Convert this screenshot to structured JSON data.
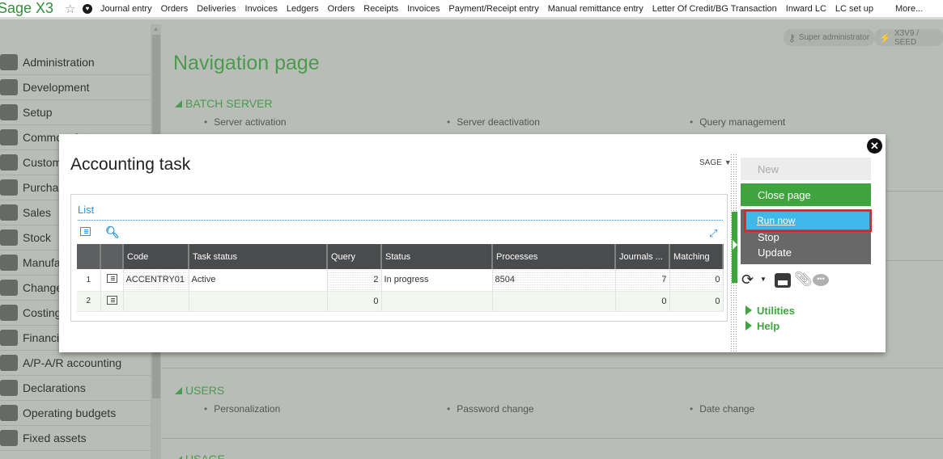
{
  "app": {
    "brand": "Sage X3",
    "favorites_icon": "star-icon",
    "shortcut_icon": "heart-icon"
  },
  "topnav": {
    "links": [
      "Journal entry",
      "Orders",
      "Deliveries",
      "Invoices",
      "Ledgers",
      "Orders",
      "Receipts",
      "Invoices",
      "Payment/Receipt entry",
      "Manual remittance entry",
      "Letter Of Credit/BG Transaction",
      "Inward LC",
      "LC set up"
    ],
    "more": "More..."
  },
  "user": {
    "role": "Super administrator",
    "role_icon": "key-icon",
    "endpoint": "X3V9 / SEED",
    "endpoint_icon": "plug-icon"
  },
  "sidebar": {
    "items": [
      {
        "label": "Administration",
        "icon": "id-badge-icon"
      },
      {
        "label": "Development",
        "icon": "hard-hat-icon"
      },
      {
        "label": "Setup",
        "icon": "gears-icon"
      },
      {
        "label": "Common data",
        "icon": "binders-icon"
      },
      {
        "label": "Customers",
        "icon": "handshake-icon"
      },
      {
        "label": "Purchasing",
        "icon": "purse-icon"
      },
      {
        "label": "Sales",
        "icon": "hand-coins-icon"
      },
      {
        "label": "Stock",
        "icon": "box-icon"
      },
      {
        "label": "Manufacturing",
        "icon": "factory-icon"
      },
      {
        "label": "Change",
        "icon": "gear-icon"
      },
      {
        "label": "Costing",
        "icon": "chart-board-icon"
      },
      {
        "label": "Financials",
        "icon": "calculator-icon"
      },
      {
        "label": "A/P-A/R accounting",
        "icon": "calendar-icon"
      },
      {
        "label": "Declarations",
        "icon": "bank-icon"
      },
      {
        "label": "Operating budgets",
        "icon": "wallet-icon"
      },
      {
        "label": "Fixed assets",
        "icon": "monitor-icon"
      }
    ]
  },
  "navigation": {
    "title": "Navigation page",
    "sections": [
      {
        "title": "BATCH SERVER",
        "links": [
          "Server activation",
          "Server deactivation",
          "Query management"
        ]
      },
      {
        "title": "USERS",
        "links": [
          "Personalization",
          "Password change",
          "Date change"
        ]
      },
      {
        "title": "USAGE",
        "links": []
      }
    ]
  },
  "modal": {
    "title": "Accounting task",
    "folder": "SAGE",
    "close_icon": "close-icon",
    "list": {
      "title": "List",
      "columns": [
        "Code",
        "Task status",
        "Query",
        "Status",
        "Processes",
        "Journals ...",
        "Matching"
      ],
      "rows": [
        {
          "num": "1",
          "code": "ACCENTRY01",
          "task_status": "Active",
          "query": "2",
          "status": "In progress",
          "processes": "8504",
          "journals": "7",
          "matching": "0"
        },
        {
          "num": "2",
          "code": "",
          "task_status": "",
          "query": "0",
          "status": "",
          "processes": "",
          "journals": "0",
          "matching": "0"
        }
      ]
    },
    "actions": {
      "new": "New",
      "close_page": "Close page",
      "run_now": "Run now",
      "stop": "Stop",
      "update": "Update"
    },
    "links": {
      "utilities": "Utilities",
      "help": "Help"
    }
  }
}
